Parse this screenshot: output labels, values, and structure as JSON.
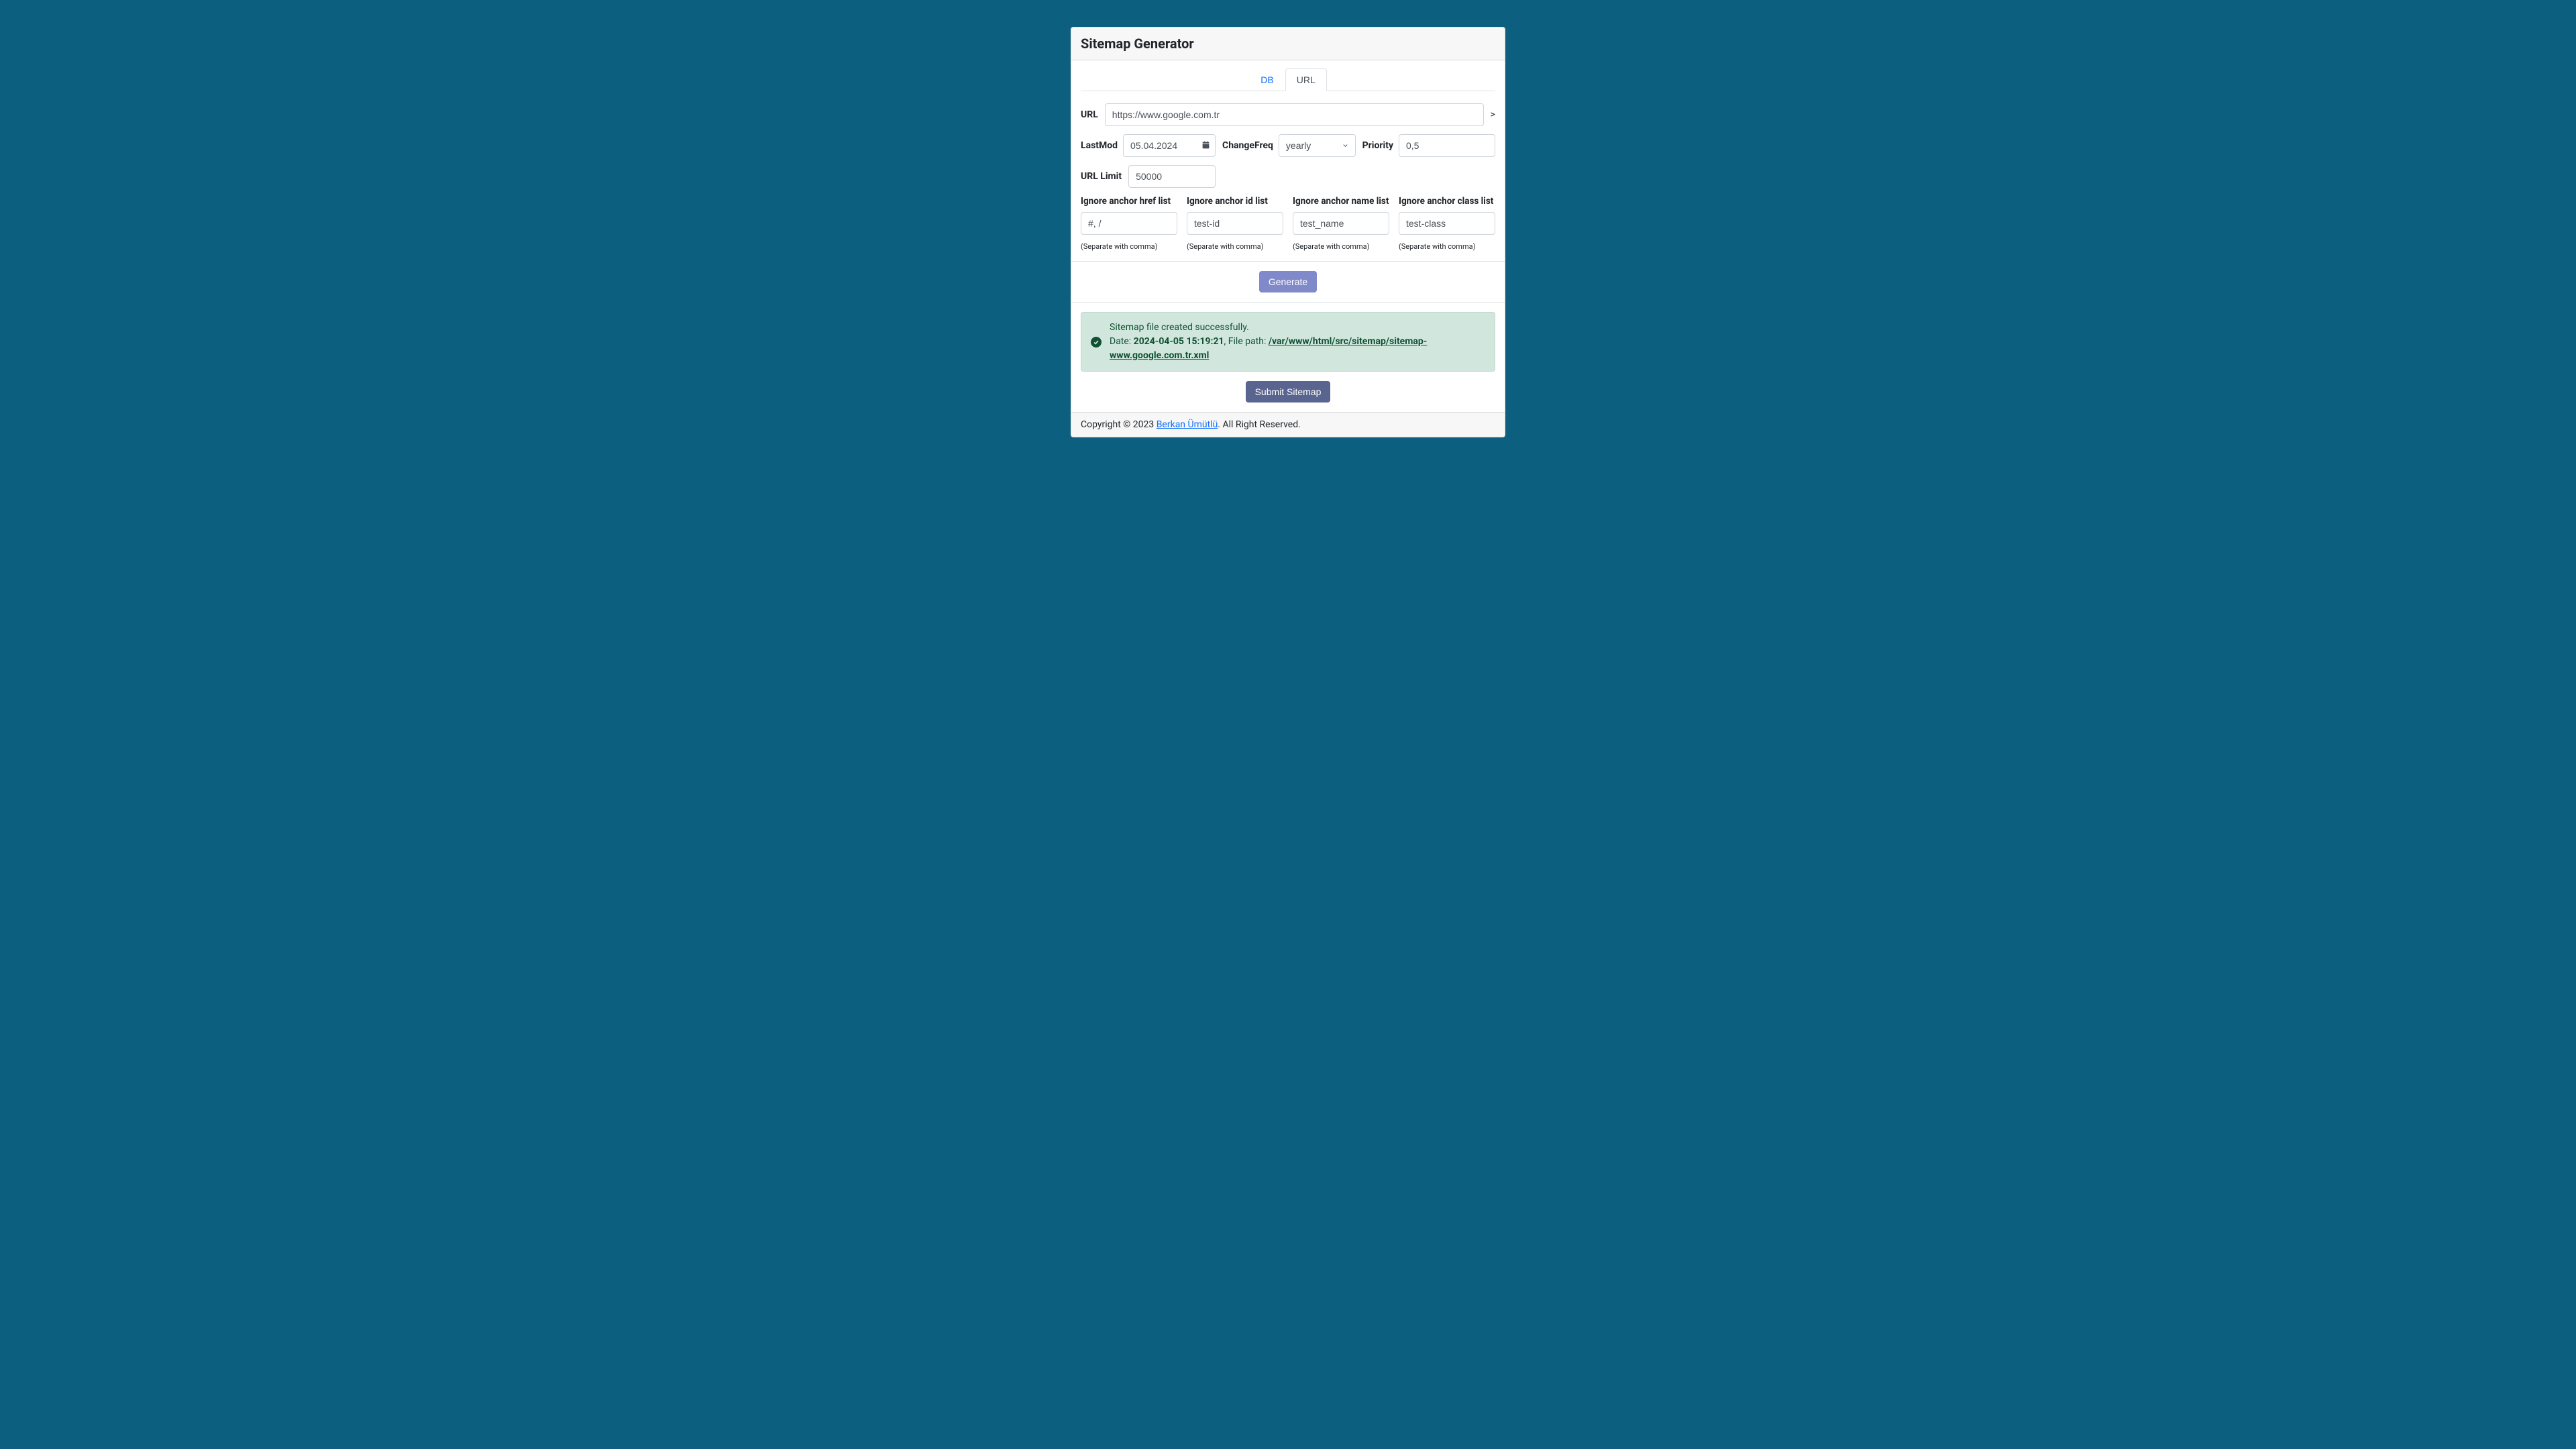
{
  "header": {
    "title": "Sitemap Generator"
  },
  "tabs": {
    "db": "DB",
    "url": "URL"
  },
  "form": {
    "url_label": "URL",
    "url_value": "https://www.google.com.tr",
    "gt": ">",
    "lastmod_label": "LastMod",
    "lastmod_value": "05.04.2024",
    "changefreq_label": "ChangeFreq",
    "changefreq_value": "yearly",
    "priority_label": "Priority",
    "priority_value": "0,5",
    "urllimit_label": "URL Limit",
    "urllimit_value": "50000",
    "ignore": {
      "href_label": "Ignore anchor href list",
      "href_value": "#, /",
      "id_label": "Ignore anchor id list",
      "id_value": "test-id",
      "name_label": "Ignore anchor name list",
      "name_value": "test_name",
      "class_label": "Ignore anchor class list",
      "class_value": "test-class",
      "hint": "(Separate with comma)"
    },
    "generate_label": "Generate",
    "submit_label": "Submit Sitemap"
  },
  "alert": {
    "line1": "Sitemap file created successfully.",
    "date_label": "Date: ",
    "date_value": "2024-04-05 15:19:21",
    "sep": ", ",
    "path_label": "File path: ",
    "path_value": "/var/www/html/src/sitemap/sitemap-www.google.com.tr.xml"
  },
  "footer": {
    "prefix": "Copyright © 2023 ",
    "author": "Berkan Ümütlü",
    "suffix": ". All Right Reserved."
  }
}
